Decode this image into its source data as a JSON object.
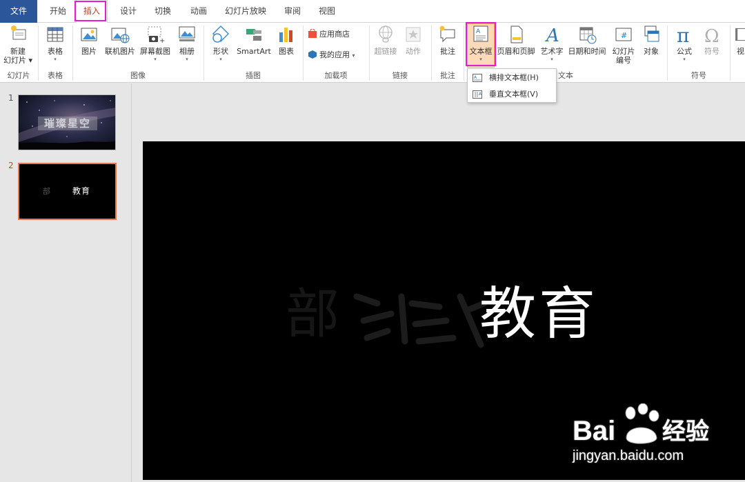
{
  "tabs": [
    "文件",
    "开始",
    "插入",
    "设计",
    "切换",
    "动画",
    "幻灯片放映",
    "审阅",
    "视图"
  ],
  "active_tab": "插入",
  "ribbon": {
    "groups": {
      "slides": "幻灯片",
      "tables": "表格",
      "images": "图像",
      "illustrations": "插图",
      "addins": "加载项",
      "links": "链接",
      "comments": "批注",
      "text": "文本",
      "symbols": "符号"
    },
    "buttons": {
      "new_slide_line1": "新建",
      "new_slide_line2": "幻灯片",
      "table": "表格",
      "picture": "图片",
      "online_picture": "联机图片",
      "screenshot": "屏幕截图",
      "album": "相册",
      "shapes": "形状",
      "smartart": "SmartArt",
      "chart": "图表",
      "store": "应用商店",
      "my_apps": "我的应用",
      "hyperlink": "超链接",
      "action": "动作",
      "comment": "批注",
      "textbox": "文本框",
      "header_footer": "页眉和页脚",
      "wordart": "艺术字",
      "datetime": "日期和时间",
      "slide_number_line1": "幻灯片",
      "slide_number_line2": "编号",
      "object": "对象",
      "equation": "公式",
      "symbol": "符号",
      "video_partial": "视"
    }
  },
  "textbox_menu": {
    "horizontal": "横排文本框(H)",
    "vertical": "垂直文本框(V)"
  },
  "slides": [
    {
      "number": "1",
      "text": "璀璨星空"
    },
    {
      "number": "2",
      "text_left": "部",
      "text_right": "教育"
    }
  ],
  "current_slide": {
    "visible_text": "教育",
    "faded_text": "部"
  },
  "watermark": {
    "brand": "Bai",
    "brand_suffix": "经验",
    "url": "jingyan.baidu.com"
  },
  "colors": {
    "file_tab": "#2b579a",
    "active_tab_text": "#c43e1c",
    "highlight": "#e51bd6",
    "pressed": "#fcd9b8",
    "selected_slide_border": "#e8764f"
  }
}
